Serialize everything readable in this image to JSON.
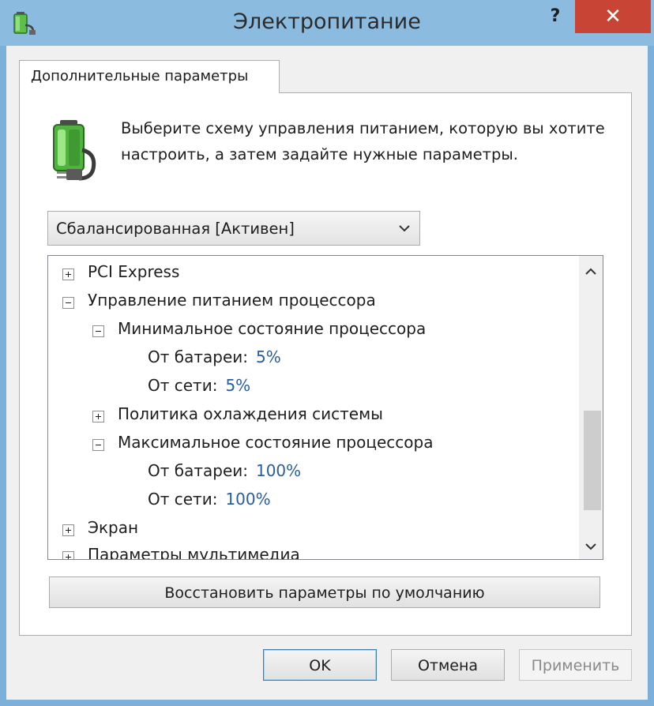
{
  "window": {
    "title": "Электропитание",
    "help_glyph": "?",
    "close_glyph": "✕"
  },
  "tab": {
    "label": "Дополнительные параметры"
  },
  "description": "Выберите схему управления питанием, которую вы хотите настроить, а затем задайте нужные параметры.",
  "plan_select": {
    "selected": "Сбалансированная [Активен]"
  },
  "tree": {
    "items": [
      {
        "label": "PCI Express",
        "expander": "plus"
      },
      {
        "label": "Управление питанием процессора",
        "expander": "minus"
      },
      {
        "label": "Минимальное состояние процессора",
        "expander": "minus"
      },
      {
        "label": "От батареи:",
        "value": "5%"
      },
      {
        "label": "От сети:",
        "value": "5%"
      },
      {
        "label": "Политика охлаждения системы",
        "expander": "plus"
      },
      {
        "label": "Максимальное состояние процессора",
        "expander": "minus"
      },
      {
        "label": "От батареи:",
        "value": "100%"
      },
      {
        "label": "От сети:",
        "value": "100%"
      },
      {
        "label": "Экран",
        "expander": "plus"
      },
      {
        "label": "Параметры мультимедиа",
        "expander": "plus"
      }
    ]
  },
  "buttons": {
    "restore": "Восстановить параметры по умолчанию",
    "ok": "OK",
    "cancel": "Отмена",
    "apply": "Применить"
  },
  "colors": {
    "titlebar": "#8cbbe0",
    "close": "#c84535",
    "value_text": "#2a5d9c"
  },
  "icons": {
    "app": "power-plug-battery-icon",
    "battery": "battery-plug-icon",
    "dropdown": "chevron-down-icon",
    "scroll_up": "chevron-up-icon",
    "scroll_down": "chevron-down-icon"
  }
}
